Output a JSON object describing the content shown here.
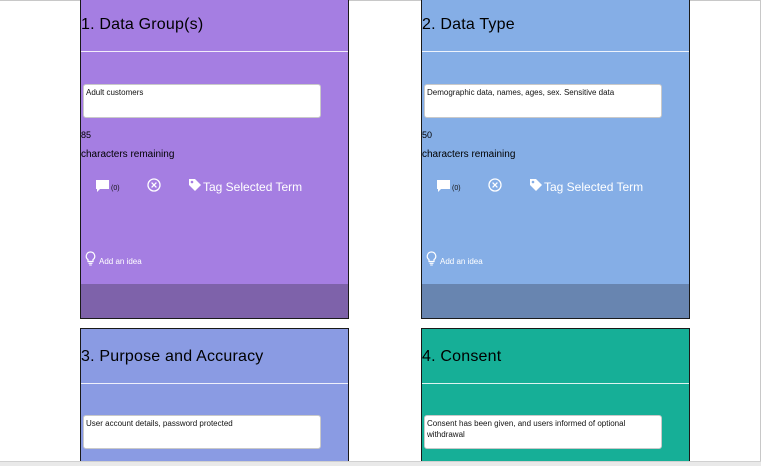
{
  "colors": {
    "card1_bg": "#A57EE2",
    "card1_footer": "#7E62AA",
    "card2_bg": "#85AEE6",
    "card2_footer": "#6885B0",
    "card3_bg": "#8A9BE3",
    "card4_bg": "#16AF97"
  },
  "cards": [
    {
      "title": "1. Data Group(s)",
      "value": "Adult customers",
      "remaining_count": "85",
      "remaining_label": "characters remaining",
      "comment_count": "(0)",
      "tag_label": "Tag Selected Term",
      "idea_label": "Add an idea"
    },
    {
      "title": "2. Data Type",
      "value": "Demographic data, names, ages, sex. Sensitive data",
      "remaining_count": "50",
      "remaining_label": "characters remaining",
      "comment_count": "(0)",
      "tag_label": "Tag Selected Term",
      "idea_label": "Add an idea"
    },
    {
      "title": "3. Purpose and Accuracy",
      "value": "User account details, password protected"
    },
    {
      "title": "4. Consent",
      "value": "Consent has been given, and users informed of optional withdrawal"
    }
  ],
  "icons": {
    "comment": "comment-icon",
    "clear": "clear-circle-icon",
    "tag": "tag-icon",
    "idea": "lightbulb-icon"
  }
}
